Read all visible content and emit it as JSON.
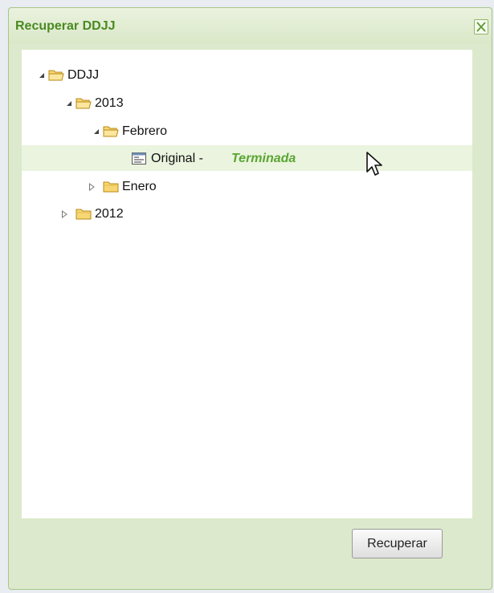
{
  "dialog": {
    "title": "Recuperar DDJJ",
    "close_label": "X"
  },
  "tree": {
    "root": {
      "label": "DDJJ",
      "expanded": true
    },
    "year_2013": {
      "label": "2013",
      "expanded": true
    },
    "febrero": {
      "label": "Febrero",
      "expanded": true
    },
    "original": {
      "label": "Original - ",
      "status": "Terminada",
      "selected": true
    },
    "enero": {
      "label": "Enero",
      "expanded": false
    },
    "year_2012": {
      "label": "2012",
      "expanded": false
    }
  },
  "footer": {
    "recover_label": "Recuperar"
  },
  "colors": {
    "accent": "#4a8a22",
    "status": "#5aa533",
    "panel": "#dce9cc",
    "selection": "#eaf4de"
  }
}
